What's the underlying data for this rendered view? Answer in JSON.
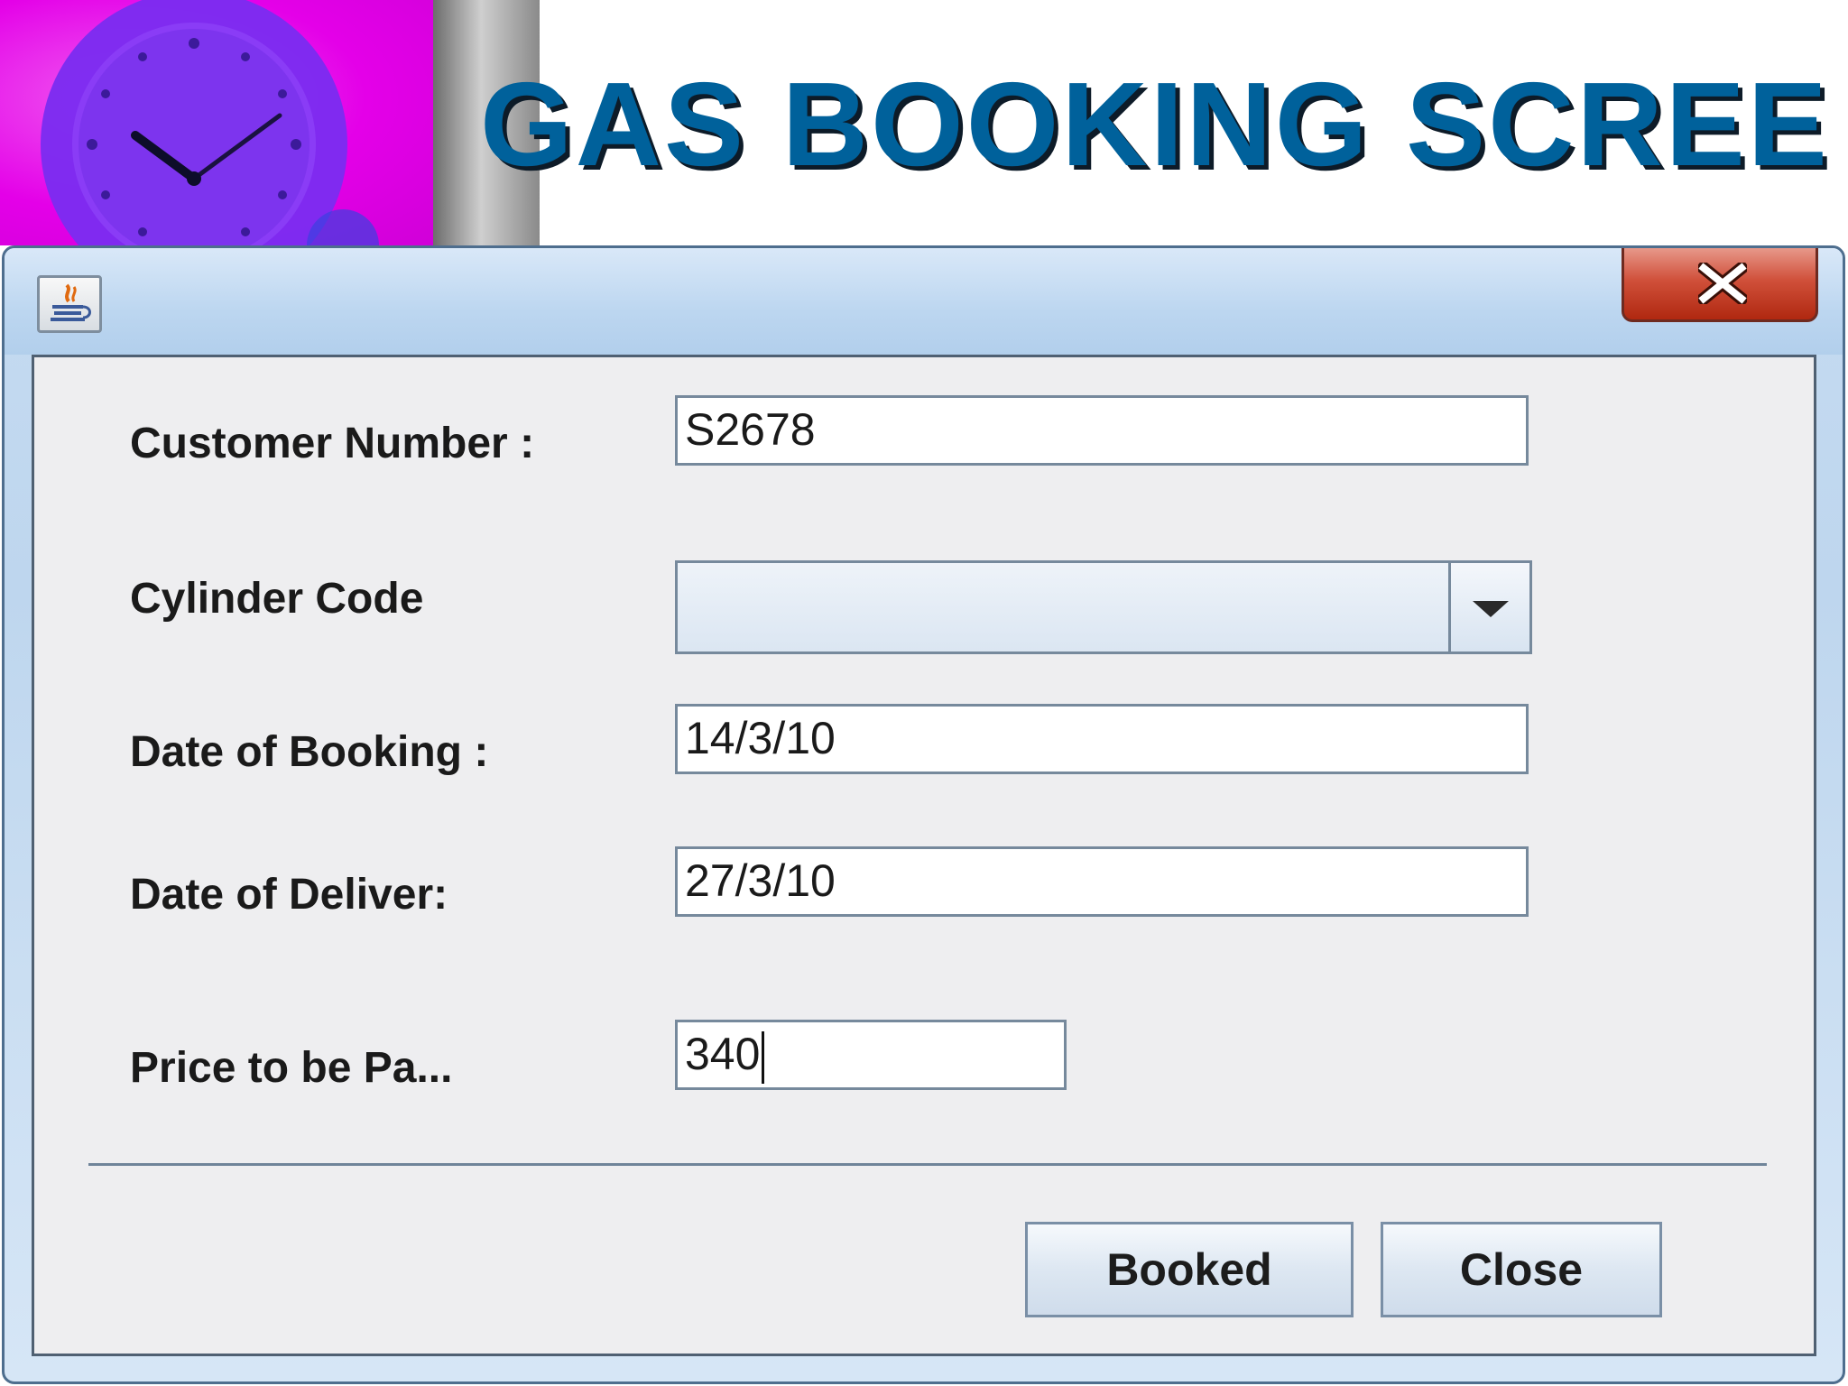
{
  "page": {
    "title": "GAS BOOKING SCREE"
  },
  "form": {
    "customer_number_label": "Customer Number :",
    "customer_number_value": "S2678",
    "cylinder_code_label": "Cylinder Code",
    "cylinder_code_value": "",
    "booking_date_label": "Date of Booking :",
    "booking_date_value": "14/3/10",
    "delivery_date_label": "Date of Deliver:",
    "delivery_date_value": "27/3/10",
    "price_label": "Price to be Pa...",
    "price_value": "340"
  },
  "buttons": {
    "booked_label": "Booked",
    "close_label": "Close"
  },
  "icons": [
    "clock-icon",
    "java-app-icon",
    "close-icon",
    "dropdown-arrow-icon"
  ],
  "colors": {
    "title_blue": "#00619b",
    "clock_magenta": "#e400e8",
    "close_red": "#c23a22"
  }
}
